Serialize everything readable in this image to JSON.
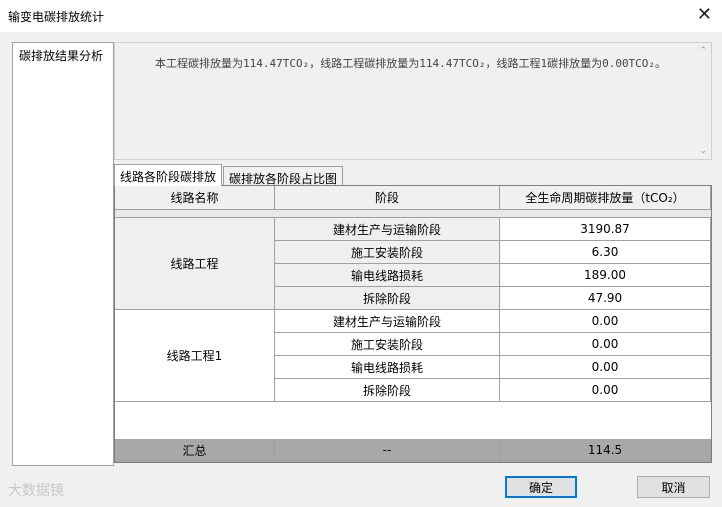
{
  "window": {
    "title": "输变电碳排放统计",
    "close_glyph": "✕"
  },
  "sidebar": {
    "items": [
      {
        "label": "碳排放结果分析"
      }
    ]
  },
  "summary": {
    "text": "本工程碳排放量为114.47TCO₂，线路工程碳排放量为114.47TCO₂，线路工程1碳排放量为0.00TCO₂。"
  },
  "tabs": [
    {
      "label": "线路各阶段碳排放"
    },
    {
      "label": "碳排放各阶段占比图"
    }
  ],
  "table": {
    "headers": [
      "线路名称",
      "阶段",
      "全生命周期碳排放量（tCO₂）"
    ],
    "groups": [
      {
        "name": "线路工程",
        "rows": [
          {
            "stage": "建材生产与运输阶段",
            "value": "3190.87"
          },
          {
            "stage": "施工安装阶段",
            "value": "6.30"
          },
          {
            "stage": "输电线路损耗",
            "value": "189.00"
          },
          {
            "stage": "拆除阶段",
            "value": "47.90"
          }
        ]
      },
      {
        "name": "线路工程1",
        "rows": [
          {
            "stage": "建材生产与运输阶段",
            "value": "0.00"
          },
          {
            "stage": "施工安装阶段",
            "value": "0.00"
          },
          {
            "stage": "输电线路损耗",
            "value": "0.00"
          },
          {
            "stage": "拆除阶段",
            "value": "0.00"
          }
        ]
      }
    ],
    "total": {
      "label": "汇总",
      "stage": "--",
      "value": "114.5"
    }
  },
  "buttons": {
    "ok": "确定",
    "cancel": "取消"
  },
  "watermark": "大数据镜"
}
